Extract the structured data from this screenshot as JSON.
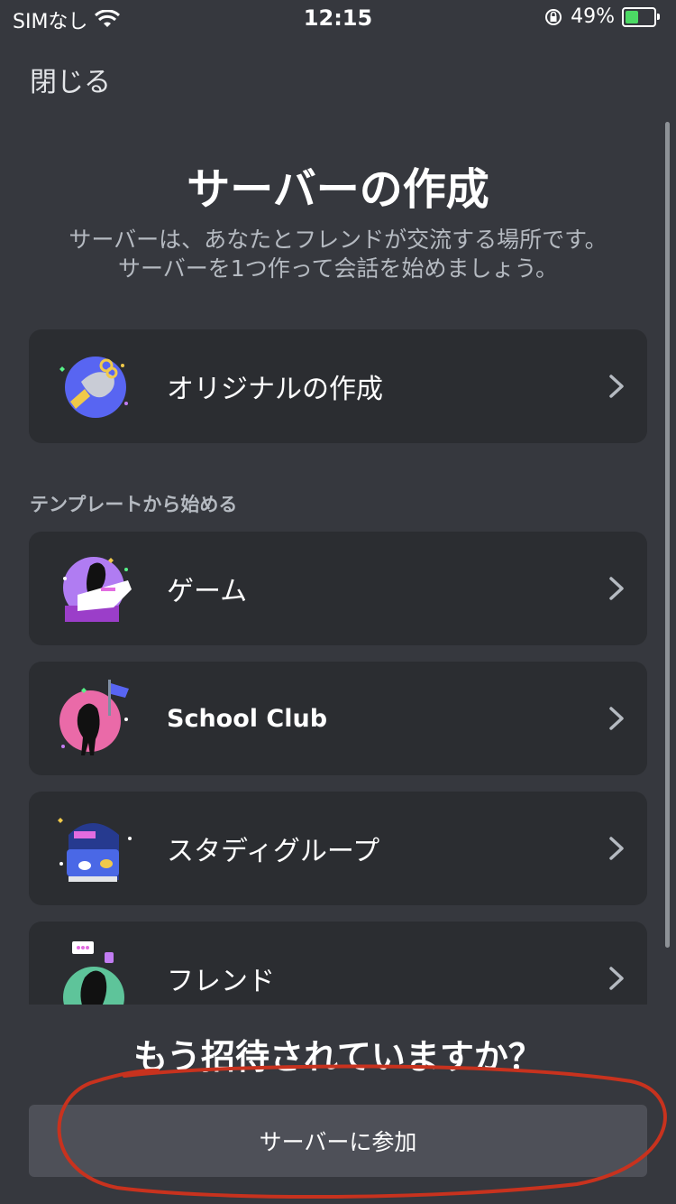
{
  "status_bar": {
    "carrier": "SIMなし",
    "time": "12:15",
    "battery": "49%"
  },
  "header": {
    "close": "閉じる"
  },
  "page": {
    "title": "サーバーの作成",
    "subtitle_line1": "サーバーは、あなたとフレンドが交流する場所です。",
    "subtitle_line2": "サーバーを1つ作って会話を始めましょう。"
  },
  "create_card": {
    "label": "オリジナルの作成"
  },
  "templates": {
    "section_label": "テンプレートから始める",
    "items": [
      {
        "label": "ゲーム"
      },
      {
        "label": "School Club"
      },
      {
        "label": "スタディグループ"
      },
      {
        "label": "フレンド"
      }
    ]
  },
  "footer": {
    "invited": "もう招待されていますか？",
    "join_label": "サーバーに参加"
  },
  "colors": {
    "background": "#36383e",
    "card": "#2b2d31",
    "button": "#4e5058",
    "annotation": "#c8321e"
  }
}
